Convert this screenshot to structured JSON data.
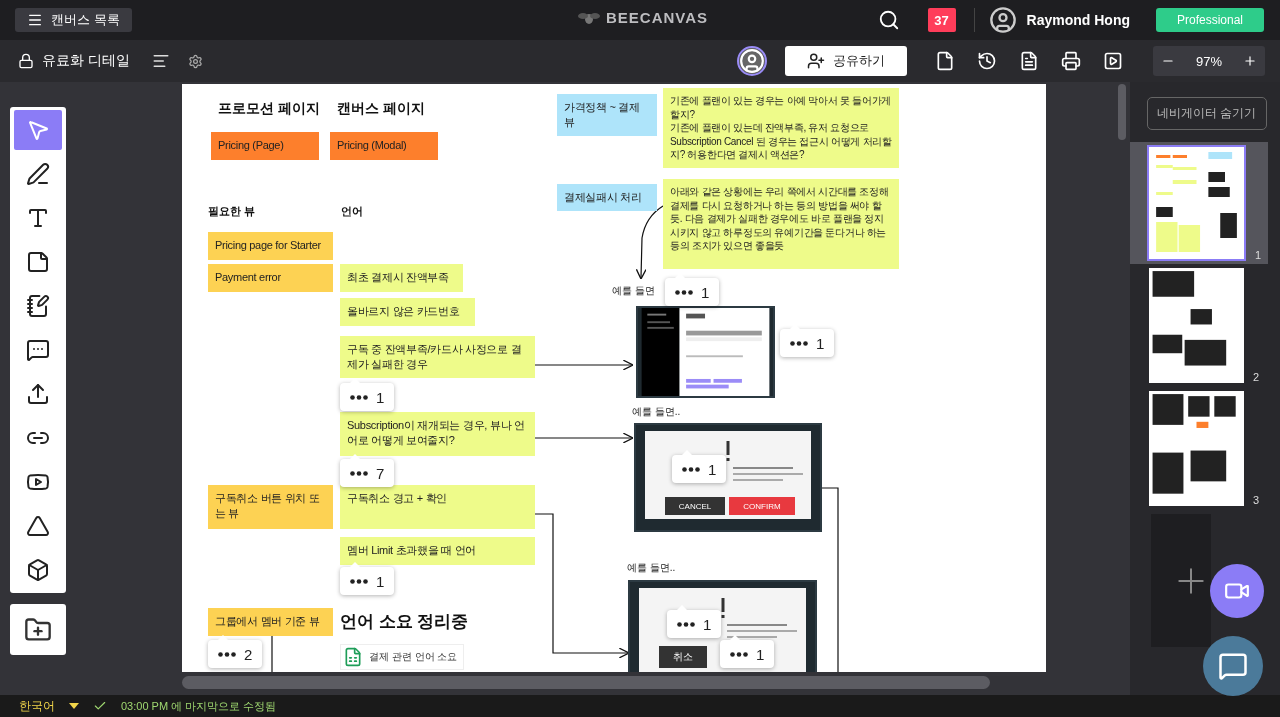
{
  "top_bar": {
    "menu_button": "캔버스 목록",
    "logo": "BEECANVAS",
    "notification_count": "37",
    "user_name": "Raymond Hong",
    "plan_badge": "Professional"
  },
  "canvas_bar": {
    "title": "유료화 디테일",
    "share_button": "공유하기",
    "zoom": "97%"
  },
  "tools": [
    {
      "kind": "select",
      "selected": true
    },
    {
      "kind": "pen",
      "selected": false
    },
    {
      "kind": "text",
      "selected": false
    },
    {
      "kind": "note",
      "selected": false
    },
    {
      "kind": "memo",
      "selected": false
    },
    {
      "kind": "comment",
      "selected": false
    },
    {
      "kind": "upload",
      "selected": false
    },
    {
      "kind": "link",
      "selected": false
    },
    {
      "kind": "youtube",
      "selected": false
    },
    {
      "kind": "drive",
      "selected": false
    },
    {
      "kind": "dropbox",
      "selected": false
    }
  ],
  "canvas": {
    "headings": [
      "프로모션 페이지",
      "캔버스 페이지"
    ],
    "column_labels": [
      "필요한 뷰",
      "언어"
    ],
    "side_notes": [
      {
        "text": "가격정책 ~ 결제 뷰",
        "color": "#aee4fa"
      },
      {
        "text": "기존에 플랜이 있는 경우는 아예 막아서 못 들어가게 할지?\n기존에 플랜이 있는데 잔액부족, 유저 요청으로 Subscription Cancel 된 경우는 접근시 어떻게 처리할지? 허용한다면 결제시 액션은?",
        "color": "#eefb8a"
      },
      {
        "text": "결제실패시 처리",
        "color": "#aee4fa"
      },
      {
        "text": "아래와 같은 상황에는 우리 쪽에서 시간대를 조정해 결제를 다시 요청하거나 하는 등의 방법을 써야 할듯. 다음 결제가 실패한 경우에도 바로 플랜을 정지시키지 않고 하루정도의 유예기간을 둔다거나 하는 등의 조치가 있으면 좋을듯",
        "color": "#eefb8a"
      }
    ],
    "cards": [
      {
        "text": "Pricing (Page)",
        "color": "#fd7f2c"
      },
      {
        "text": "Pricing (Modal)",
        "color": "#fd7f2c"
      },
      {
        "text": "Pricing page for Starter",
        "color": "#fdd253"
      },
      {
        "text": "Payment error",
        "color": "#fdd253"
      },
      {
        "text": "최초 결제시 잔액부족",
        "color": "#eefb8a"
      },
      {
        "text": "올바르지 않은 카드번호",
        "color": "#eefb8a"
      },
      {
        "text": "구독 중 잔액부족/카드사 사정으로 결제가 실패한 경우",
        "color": "#eefb8a"
      },
      {
        "text": "Subscription이 재개되는 경우, 뷰나 언어로 어떻게 보여줄지?",
        "color": "#eefb8a"
      },
      {
        "text": "구독취소 버튼 위치 또는 뷰",
        "color": "#fdd253"
      },
      {
        "text": "구독취소 경고 + 확인",
        "color": "#eefb8a"
      },
      {
        "text": "멤버 Limit 초과했을 때 언어",
        "color": "#eefb8a"
      },
      {
        "text": "그룹에서 멤버 기준 뷰",
        "color": "#fdd253"
      }
    ],
    "comments": [
      {
        "count": "1"
      },
      {
        "count": "1"
      },
      {
        "count": "1"
      },
      {
        "count": "7"
      },
      {
        "count": "1"
      },
      {
        "count": "1"
      },
      {
        "count": "2"
      },
      {
        "count": "1"
      },
      {
        "count": "1"
      }
    ],
    "example_labels": [
      "예를 들면",
      "예를 들면..",
      "예를 들면.."
    ],
    "screenshots": [
      {
        "kind": "table"
      },
      {
        "kind": "dialog",
        "buttons": [
          "CANCEL",
          "CONFIRM"
        ]
      },
      {
        "kind": "dialog",
        "buttons": [
          "취소"
        ]
      }
    ],
    "section_title": "언어 소요 정리중",
    "file_name": "결제 관련 언어 소요"
  },
  "navigator": {
    "hide_button": "네비게이터 숨기기",
    "pages": [
      {
        "number": "1",
        "selected": true
      },
      {
        "number": "2",
        "selected": false
      },
      {
        "number": "3",
        "selected": false
      }
    ]
  },
  "status_bar": {
    "language": "한국어",
    "saved_text": "03:00 PM 에 마지막으로 수정됨"
  }
}
